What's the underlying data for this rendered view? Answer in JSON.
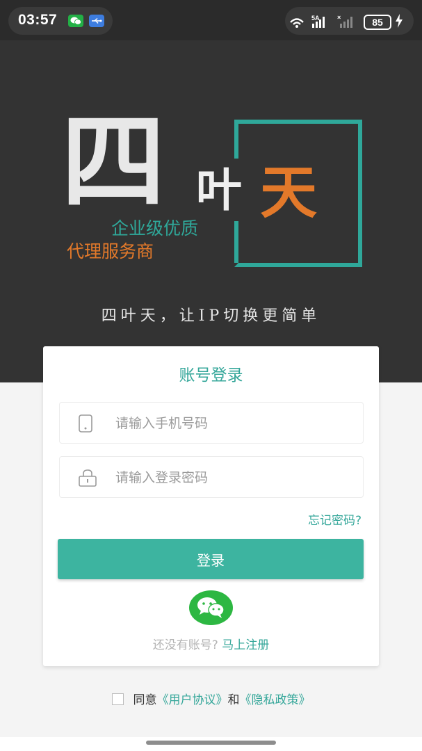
{
  "status_bar": {
    "time": "03:57",
    "battery": "85"
  },
  "brand": {
    "char_si": "四",
    "char_ye": "叶",
    "char_tian": "天",
    "tagline_line1": "企业级优质",
    "tagline_line2": "代理服务商",
    "slogan": "四叶天，让IP切换更简单",
    "colors": {
      "teal": "#2fa89a",
      "orange": "#e3792a"
    }
  },
  "login": {
    "title": "账号登录",
    "phone_placeholder": "请输入手机号码",
    "password_placeholder": "请输入登录密码",
    "forgot_password": "忘记密码?",
    "login_button": "登录",
    "no_account_text": "还没有账号?",
    "register_link": "马上注册"
  },
  "agreement": {
    "prefix": "同意",
    "user_agreement": "《用户协议》",
    "and": "和",
    "privacy_policy": "《隐私政策》"
  }
}
